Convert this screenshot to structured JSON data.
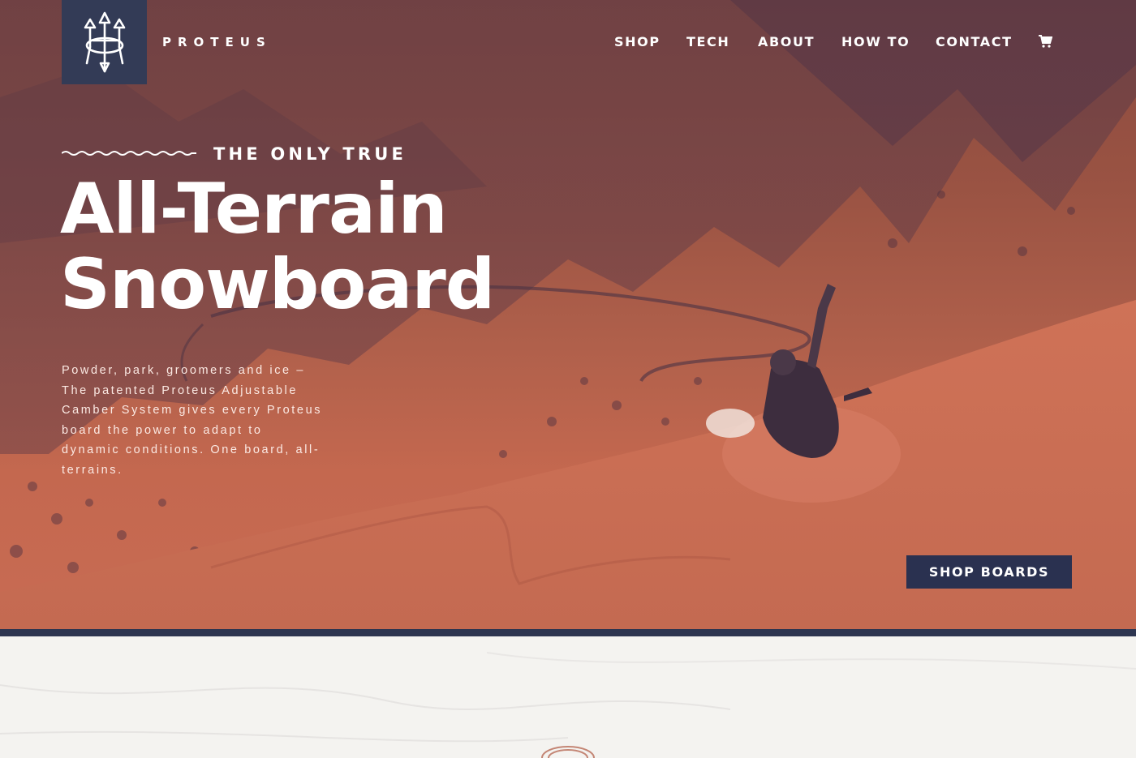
{
  "brand": {
    "name": "PROTEUS",
    "logo_icon": "trident-icon"
  },
  "nav": {
    "items": [
      {
        "label": "SHOP"
      },
      {
        "label": "TECH"
      },
      {
        "label": "ABOUT"
      },
      {
        "label": "HOW TO"
      },
      {
        "label": "CONTACT"
      }
    ],
    "cart_icon": "cart-icon"
  },
  "hero": {
    "eyebrow": "THE ONLY TRUE",
    "headline_line1": "All-Terrain",
    "headline_line2": "Snowboard",
    "body": "Powder, park, groomers and ice – The patented Proteus Adjustable Camber System gives every Proteus board the power to adapt to dynamic conditions. One board, all-terrains.",
    "cta_label": "SHOP BOARDS"
  },
  "colors": {
    "navy": "#2d3550",
    "hero_overlay": "#c0674f",
    "background_light": "#f4f3f0"
  }
}
